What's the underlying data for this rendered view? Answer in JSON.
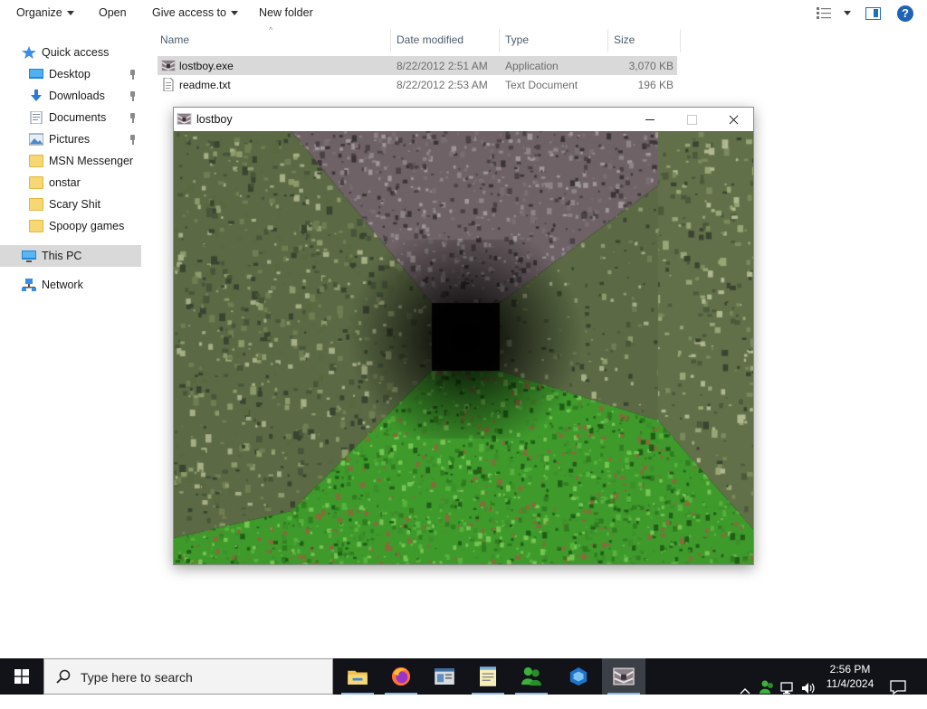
{
  "explorer": {
    "toolbar": {
      "organize": "Organize",
      "open": "Open",
      "give_access": "Give access to",
      "new_folder": "New folder",
      "help": "?"
    },
    "nav": {
      "quick_access": "Quick access",
      "desktop": "Desktop",
      "downloads": "Downloads",
      "documents": "Documents",
      "pictures": "Pictures",
      "msn": "MSN Messenger",
      "onstar": "onstar",
      "scary": "Scary Shit",
      "spoopy": "Spoopy games",
      "this_pc": "This PC",
      "network": "Network"
    },
    "columns": {
      "name": "Name",
      "date": "Date modified",
      "type": "Type",
      "size": "Size"
    },
    "files": [
      {
        "name": "lostboy.exe",
        "date": "8/22/2012 2:51 AM",
        "type": "Application",
        "size": "3,070 KB",
        "selected": true
      },
      {
        "name": "readme.txt",
        "date": "8/22/2012 2:53 AM",
        "type": "Text Document",
        "size": "196 KB",
        "selected": false
      }
    ]
  },
  "game_window": {
    "title": "lostboy",
    "colors": {
      "ceiling": "#6e6266",
      "wall": "#5b6a45",
      "floor": "#3f9a2c",
      "void": "#050505"
    }
  },
  "taskbar": {
    "search_placeholder": "Type here to search",
    "apps": [
      "file-explorer",
      "firefox",
      "app-window",
      "notepad",
      "msn-messenger",
      "blue-app",
      "lostboy"
    ],
    "clock_time": "2:56 PM",
    "clock_date": "11/4/2024"
  }
}
